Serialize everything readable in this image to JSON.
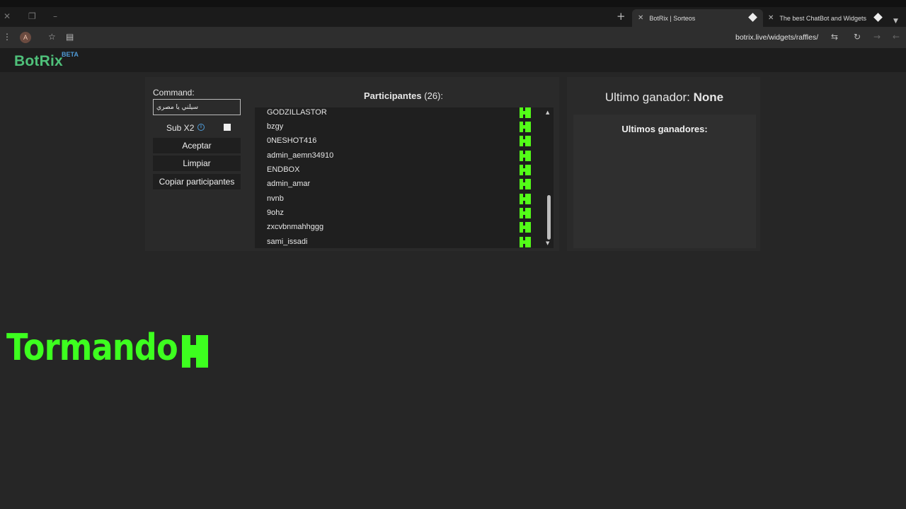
{
  "browser": {
    "tabs": [
      {
        "label": "BotRix | Sorteos",
        "active": true
      },
      {
        "label": "The best ChatBot and Widgets",
        "active": false
      }
    ],
    "url": "botrix.live/widgets/raffles/",
    "profile_initial": "A"
  },
  "site": {
    "logo": "BotRix",
    "badge": "BETA"
  },
  "controls": {
    "command_label": "Command:",
    "command_value": "سيلني يا مصري",
    "sub_label": "Sub X2",
    "accept_label": "Aceptar",
    "clear_label": "Limpiar",
    "copy_label": "Copiar participantes"
  },
  "participants": {
    "title": "Participantes",
    "count": "(26):",
    "items": [
      "GODZILLASTOR",
      "bzgy",
      "0NESHOT416",
      "admin_aemn34910",
      "ENDBOX",
      "admin_amar",
      "nvnb",
      "9ohz",
      "zxcvbnmahhggg",
      "sami_issadi"
    ]
  },
  "winner": {
    "label": "Ultimo ganador:",
    "value": "None",
    "history_title": "Ultimos ganadores:"
  },
  "overlay": {
    "text": "Tormando"
  },
  "colors": {
    "kick_green": "#53fc18",
    "logo_green": "#4fc07a",
    "overlay_green": "#3dff1f",
    "beta_blue": "#4f9bd8"
  }
}
